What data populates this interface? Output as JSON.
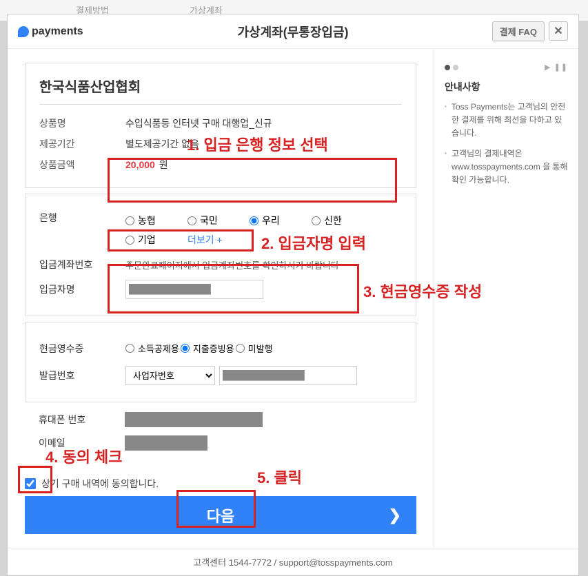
{
  "background": {
    "label": "결제방법",
    "value": "가상계좌"
  },
  "header": {
    "logo_text": "payments",
    "title": "가상계좌(무통장입금)",
    "faq_label": "결제 FAQ",
    "close_label": "✕"
  },
  "merchant": {
    "name": "한국식품산업협회",
    "rows": {
      "product_label": "상품명",
      "product_value": "수입식품등 인터넷 구매 대행업_신규",
      "period_label": "제공기간",
      "period_value": "별도제공기간 없음",
      "amount_label": "상품금액",
      "amount_value": "20,000",
      "amount_unit": "원"
    }
  },
  "bank_section": {
    "bank_label": "은행",
    "banks": [
      "농협",
      "국민",
      "우리",
      "신한",
      "기업"
    ],
    "selected_bank": "우리",
    "more_label": "더보기 +",
    "account_label": "입금계좌번호",
    "account_notice": "주문완료페이지에서 입금계좌번호를 확인하시기 바랍니다",
    "depositor_label": "입금자명"
  },
  "receipt_section": {
    "receipt_label": "현금영수증",
    "options": [
      "소득공제용",
      "지출증빙용",
      "미발행"
    ],
    "selected_option": "지출증빙용",
    "issue_label": "발급번호",
    "select_value": "사업자번호"
  },
  "contact": {
    "phone_label": "휴대폰 번호",
    "email_label": "이메일"
  },
  "agree": {
    "text": "상기 구매 내역에 동의합니다.",
    "checked": true
  },
  "next_label": "다음",
  "sidebar": {
    "title": "안내사항",
    "item1": "Toss Payments는 고객님의 안전한 결제를 위해 최선을 다하고 있습니다.",
    "item2_prefix": "고객님의 결제내역은",
    "item2_link": "www.tosspayments.com",
    "item2_suffix": "을 통해 확인 가능합니다."
  },
  "footer": {
    "text": "고객센터 1544-7772 / support@tosspayments.com"
  },
  "annotations": {
    "a1": "1. 입금 은행 정보 선택",
    "a2": "2. 입금자명 입력",
    "a3": "3. 현금영수증 작성",
    "a4": "4. 동의 체크",
    "a5": "5. 클릭"
  }
}
